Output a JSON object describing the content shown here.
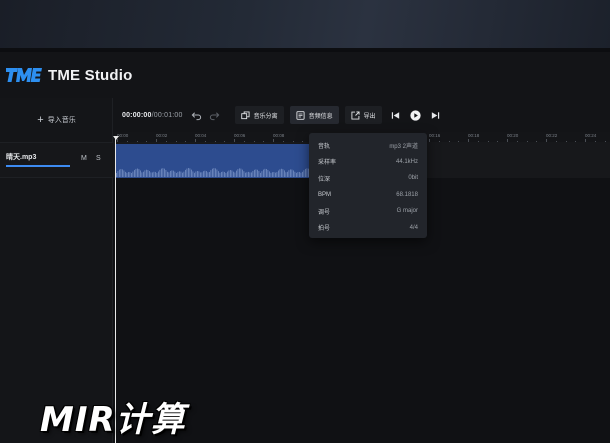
{
  "app": {
    "title": "TME Studio"
  },
  "sidebar": {
    "import_label": "导入音乐",
    "track": {
      "name": "晴天.mp3",
      "progress": 1.0,
      "mute_label": "M",
      "solo_label": "S"
    }
  },
  "toolbar": {
    "time_current": "00:00:00",
    "time_total": "/00:01:00",
    "separate_label": "音乐分离",
    "info_label": "音频信息",
    "export_label": "导出"
  },
  "ruler": {
    "labels": [
      "00:00",
      "00:02",
      "00:04",
      "00:06",
      "00:08",
      "00:10",
      "00:12",
      "00:14",
      "00:16",
      "00:18",
      "00:20",
      "00:22",
      "00:24"
    ]
  },
  "info_panel": {
    "rows": [
      {
        "key": "音轨",
        "value": "mp3 2声道"
      },
      {
        "key": "采样率",
        "value": "44.1kHz"
      },
      {
        "key": "位深",
        "value": "0bit"
      },
      {
        "key": "BPM",
        "value": "68.1818"
      },
      {
        "key": "调号",
        "value": "G major"
      },
      {
        "key": "拍号",
        "value": "4/4"
      }
    ]
  },
  "watermark": {
    "text": "MIR计算"
  },
  "colors": {
    "accent": "#3d8bf2",
    "clip": "#2d4c8f",
    "logo": "#2d8ff0"
  }
}
